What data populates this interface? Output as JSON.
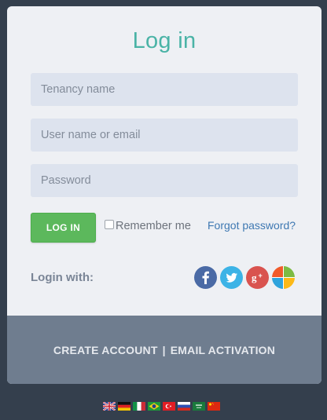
{
  "login": {
    "title": "Log in",
    "tenancy_placeholder": "Tenancy name",
    "username_placeholder": "User name or email",
    "password_placeholder": "Password",
    "login_button": "LOG IN",
    "remember_me": "Remember me",
    "forgot_password": "Forgot password?",
    "login_with": "Login with:",
    "social": [
      "facebook-icon",
      "twitter-icon",
      "google-plus-icon",
      "microsoft-icon"
    ]
  },
  "footer": {
    "create_account": "CREATE ACCOUNT",
    "separator": "|",
    "email_activation": "EMAIL ACTIVATION"
  },
  "languages": [
    "English",
    "German",
    "Italian",
    "Portuguese (Brazil)",
    "Turkish",
    "Russian",
    "Arabic",
    "Chinese"
  ],
  "colors": {
    "background": "#343f4d",
    "card": "#eef0f4",
    "title": "#4ab3a6",
    "button": "#5cb85c",
    "link": "#3e78b2",
    "footer": "#6f7d8f"
  }
}
